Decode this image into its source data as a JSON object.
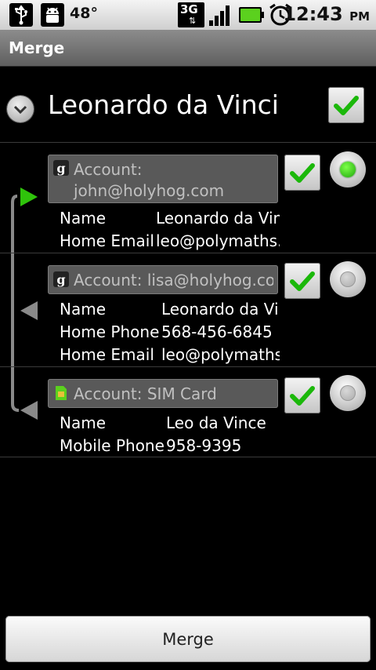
{
  "status_bar": {
    "temperature": "48°",
    "network": "3G",
    "time": "12:43",
    "ampm": "PM",
    "icons": [
      "usb-icon",
      "android-debug-icon",
      "3g-data-icon",
      "signal-icon",
      "battery-icon",
      "alarm-clock-icon"
    ],
    "battery_color": "#5bd11e"
  },
  "title_bar": {
    "title": "Merge"
  },
  "contact": {
    "name": "Leonardo da Vinci",
    "checked": true
  },
  "accounts": [
    {
      "account_label": "Account: john@holyhog.com",
      "account_icon": "google-icon",
      "fields": [
        {
          "label": "Name",
          "value": "Leonardo da Vinc"
        },
        {
          "label": "Home Email",
          "value": "leo@polymaths.c"
        }
      ],
      "checked": true,
      "selected": true
    },
    {
      "account_label": "Account: lisa@holyhog.com",
      "account_icon": "google-icon",
      "fields": [
        {
          "label": "Name",
          "value": "Leonardo da Vin"
        },
        {
          "label": "Home Phone",
          "value": "568-456-6845"
        },
        {
          "label": "Home Email",
          "value": "leo@polymaths.c"
        }
      ],
      "checked": true,
      "selected": false
    },
    {
      "account_label": "Account: SIM Card",
      "account_icon": "sim-card-icon",
      "fields": [
        {
          "label": "Name",
          "value": "Leo da Vince"
        },
        {
          "label": "Mobile Phone",
          "value": "958-9395"
        }
      ],
      "checked": true,
      "selected": false
    }
  ],
  "merge_button": {
    "label": "Merge"
  },
  "colors": {
    "accent_green": "#2fc40b",
    "check_green": "#1bb80a"
  }
}
